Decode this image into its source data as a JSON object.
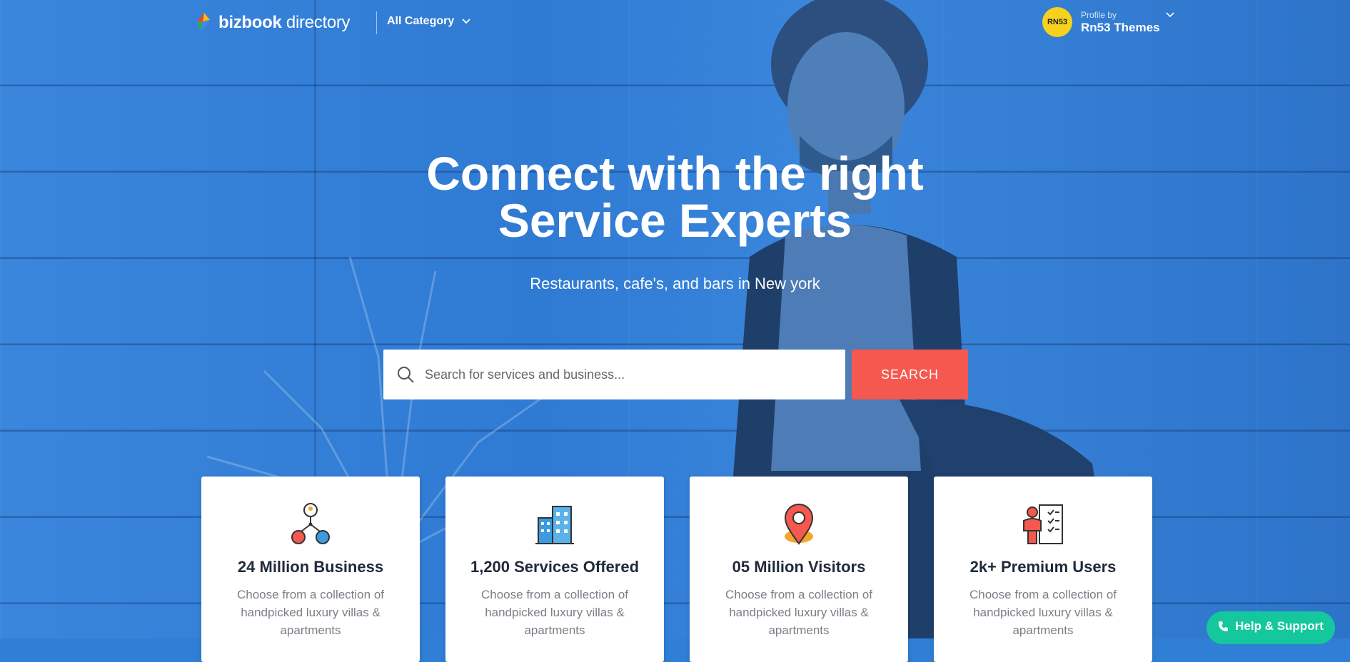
{
  "header": {
    "logo_bold": "bizbook",
    "logo_light": " directory",
    "category_label": "All Category",
    "profile": {
      "avatar_text": "RN53",
      "sub_label": "Profile by",
      "name": "Rn53 Themes"
    }
  },
  "hero": {
    "headline_line1": "Connect with the right",
    "headline_line2": "Service Experts",
    "subheadline": "Restaurants, cafe's, and bars in New york",
    "search": {
      "placeholder": "Search for services and business...",
      "value": "",
      "button_label": "SEARCH"
    }
  },
  "cards": [
    {
      "icon": "network-users-icon",
      "title": "24 Million Business",
      "desc": "Choose from a collection of handpicked luxury villas & apartments"
    },
    {
      "icon": "buildings-icon",
      "title": "1,200 Services Offered",
      "desc": "Choose from a collection of handpicked luxury villas & apartments"
    },
    {
      "icon": "map-pin-icon",
      "title": "05 Million Visitors",
      "desc": "Choose from a collection of handpicked luxury villas & apartments"
    },
    {
      "icon": "checklist-user-icon",
      "title": "2k+ Premium Users",
      "desc": "Choose from a collection of handpicked luxury villas & apartments"
    }
  ],
  "help": {
    "label": "Help & Support"
  },
  "colors": {
    "hero_blue": "#2f7fd6",
    "search_button": "#f4584f",
    "help_button": "#14c79c",
    "avatar_bg": "#f7d21c"
  }
}
